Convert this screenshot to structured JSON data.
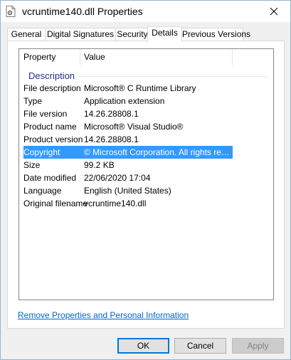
{
  "window": {
    "title": "vcruntime140.dll Properties"
  },
  "tabs": [
    {
      "label": "General"
    },
    {
      "label": "Digital Signatures"
    },
    {
      "label": "Security"
    },
    {
      "label": "Details"
    },
    {
      "label": "Previous Versions"
    }
  ],
  "active_tab": "Details",
  "details": {
    "header": {
      "property": "Property",
      "value": "Value"
    },
    "group": "Description",
    "rows": [
      {
        "property": "File description",
        "value": "Microsoft® C Runtime Library"
      },
      {
        "property": "Type",
        "value": "Application extension"
      },
      {
        "property": "File version",
        "value": "14.26.28808.1"
      },
      {
        "property": "Product name",
        "value": "Microsoft® Visual Studio®"
      },
      {
        "property": "Product version",
        "value": "14.26.28808.1"
      },
      {
        "property": "Copyright",
        "value": "© Microsoft Corporation. All rights reserv..."
      },
      {
        "property": "Size",
        "value": "99.2 KB"
      },
      {
        "property": "Date modified",
        "value": "22/06/2020 17:04"
      },
      {
        "property": "Language",
        "value": "English (United States)"
      },
      {
        "property": "Original filename",
        "value": "vcruntime140.dll"
      }
    ],
    "selected_row": "Copyright"
  },
  "link": "Remove Properties and Personal Information",
  "buttons": {
    "ok": "OK",
    "cancel": "Cancel",
    "apply": "Apply"
  },
  "colors": {
    "selection": "#3399ff",
    "group_text": "#1e3287",
    "link": "#0066cc",
    "default_button_border": "#0078d7"
  },
  "icons": {
    "title": "dll-file-icon",
    "close": "close-icon"
  }
}
